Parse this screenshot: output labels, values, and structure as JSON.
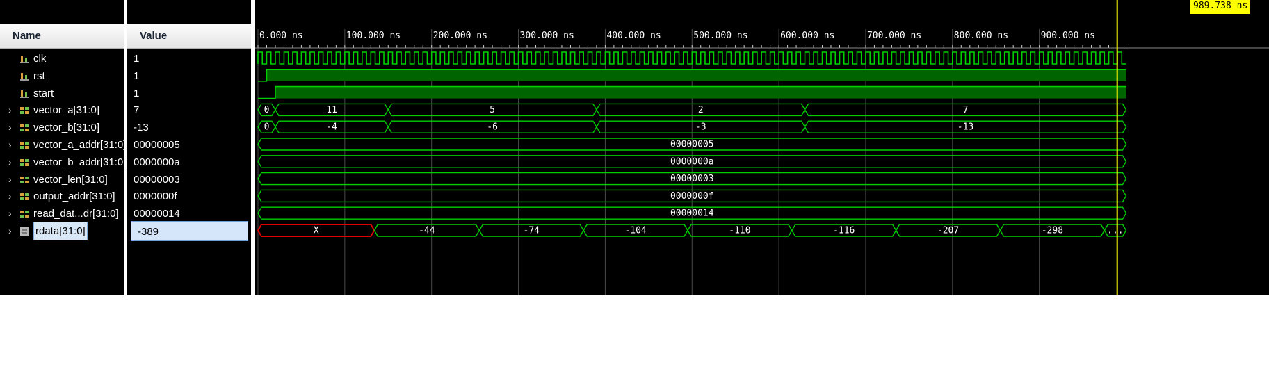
{
  "columns": {
    "name_header": "Name",
    "value_header": "Value"
  },
  "cursor": {
    "label": "989.738 ns",
    "time_ns": 989.738
  },
  "timeline": {
    "max_ns": 1000,
    "ticks": [
      {
        "t": 0,
        "label": "0.000 ns"
      },
      {
        "t": 100,
        "label": "100.000 ns"
      },
      {
        "t": 200,
        "label": "200.000 ns"
      },
      {
        "t": 300,
        "label": "300.000 ns"
      },
      {
        "t": 400,
        "label": "400.000 ns"
      },
      {
        "t": 500,
        "label": "500.000 ns"
      },
      {
        "t": 600,
        "label": "600.000 ns"
      },
      {
        "t": 700,
        "label": "700.000 ns"
      },
      {
        "t": 800,
        "label": "800.000 ns"
      },
      {
        "t": 900,
        "label": "900.000 ns"
      }
    ]
  },
  "colors": {
    "wave": "#00d000",
    "wave_fill": "#006400",
    "undefined": "#e00000",
    "cursor": "#ffff00",
    "grid": "#4a4a4a"
  },
  "signals": [
    {
      "name": "clk",
      "value": "1",
      "kind": "bit",
      "expandable": false,
      "icon": "bit-signal-icon",
      "clock_period_ns": 10
    },
    {
      "name": "rst",
      "value": "1",
      "kind": "bit",
      "expandable": false,
      "icon": "bit-signal-icon",
      "rise_ns": 10
    },
    {
      "name": "start",
      "value": "1",
      "kind": "bit",
      "expandable": false,
      "icon": "bit-signal-icon",
      "rise_ns": 20
    },
    {
      "name": "vector_a[31:0]",
      "value": "7",
      "kind": "bus",
      "expandable": true,
      "icon": "bus-signal-icon",
      "segments": [
        {
          "start": 0,
          "end": 20,
          "label": "0"
        },
        {
          "start": 20,
          "end": 150,
          "label": "11"
        },
        {
          "start": 150,
          "end": 390,
          "label": "5"
        },
        {
          "start": 390,
          "end": 630,
          "label": "2"
        },
        {
          "start": 630,
          "end": 1000,
          "label": "7"
        }
      ]
    },
    {
      "name": "vector_b[31:0]",
      "value": "-13",
      "kind": "bus",
      "expandable": true,
      "icon": "bus-signal-icon",
      "segments": [
        {
          "start": 0,
          "end": 20,
          "label": "0"
        },
        {
          "start": 20,
          "end": 150,
          "label": "-4"
        },
        {
          "start": 150,
          "end": 390,
          "label": "-6"
        },
        {
          "start": 390,
          "end": 630,
          "label": "-3"
        },
        {
          "start": 630,
          "end": 1000,
          "label": "-13"
        }
      ]
    },
    {
      "name": "vector_a_addr[31:0]",
      "value": "00000005",
      "kind": "bus",
      "expandable": true,
      "icon": "bus-signal-icon",
      "segments": [
        {
          "start": 0,
          "end": 1000,
          "label": "00000005"
        }
      ]
    },
    {
      "name": "vector_b_addr[31:0]",
      "value": "0000000a",
      "kind": "bus",
      "expandable": true,
      "icon": "bus-signal-icon",
      "segments": [
        {
          "start": 0,
          "end": 1000,
          "label": "0000000a"
        }
      ]
    },
    {
      "name": "vector_len[31:0]",
      "value": "00000003",
      "kind": "bus",
      "expandable": true,
      "icon": "bus-signal-icon",
      "segments": [
        {
          "start": 0,
          "end": 1000,
          "label": "00000003"
        }
      ]
    },
    {
      "name": "output_addr[31:0]",
      "value": "0000000f",
      "kind": "bus",
      "expandable": true,
      "icon": "bus-signal-icon",
      "segments": [
        {
          "start": 0,
          "end": 1000,
          "label": "0000000f"
        }
      ]
    },
    {
      "name": "read_dat...dr[31:0]",
      "value": "00000014",
      "kind": "bus",
      "expandable": true,
      "icon": "bus-signal-icon",
      "segments": [
        {
          "start": 0,
          "end": 1000,
          "label": "00000014"
        }
      ]
    },
    {
      "name": "rdata[31:0]",
      "value": "-389",
      "kind": "bus",
      "expandable": true,
      "icon": "memory-signal-icon",
      "selected": true,
      "segments": [
        {
          "start": 0,
          "end": 134,
          "label": "X",
          "undefined": true
        },
        {
          "start": 134,
          "end": 255,
          "label": "-44"
        },
        {
          "start": 255,
          "end": 375,
          "label": "-74"
        },
        {
          "start": 375,
          "end": 495,
          "label": "-104"
        },
        {
          "start": 495,
          "end": 615,
          "label": "-110"
        },
        {
          "start": 615,
          "end": 735,
          "label": "-116"
        },
        {
          "start": 735,
          "end": 855,
          "label": "-207"
        },
        {
          "start": 855,
          "end": 975,
          "label": "-298"
        },
        {
          "start": 975,
          "end": 1000,
          "label": "..."
        }
      ]
    }
  ]
}
